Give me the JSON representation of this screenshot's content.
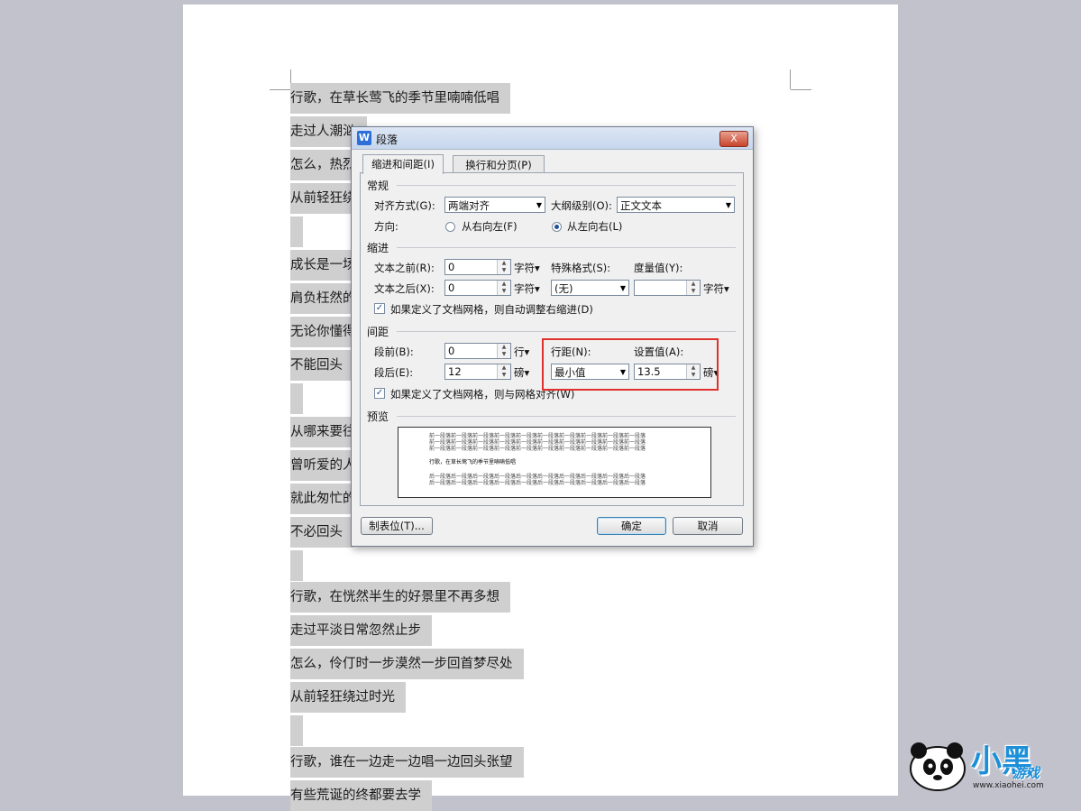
{
  "document": {
    "lines": [
      "行歌，在草长莺飞的季节里喃喃低唱",
      "走过人潮汹",
      "怎么，热烈",
      "从前轻狂绕",
      "",
      "成长是一场",
      "肩负枉然的",
      "无论你懂得",
      "不能回头",
      "",
      "从哪来要往",
      "曾听爱的人",
      "就此匆忙的",
      "不必回头",
      "",
      "行歌，在恍然半生的好景里不再多想",
      "走过平淡日常忽然止步",
      "怎么，伶仃时一步漠然一步回首梦尽处",
      "从前轻狂绕过时光",
      "",
      "行歌，谁在一边走一边唱一边回头张望",
      "有些荒诞的终都要去学"
    ]
  },
  "dialog": {
    "title": "段落",
    "close_label": "X",
    "tabs": [
      {
        "label": "缩进和间距(I)",
        "active": true
      },
      {
        "label": "换行和分页(P)",
        "active": false
      }
    ],
    "general": {
      "section_title": "常规",
      "alignment_label": "对齐方式(G):",
      "alignment_value": "两端对齐",
      "outline_label": "大纲级别(O):",
      "outline_value": "正文文本",
      "direction_label": "方向:",
      "rtl_label": "从右向左(F)",
      "ltr_label": "从左向右(L)",
      "direction_selected": "ltr"
    },
    "indent": {
      "section_title": "缩进",
      "before_label": "文本之前(R):",
      "before_value": "0",
      "before_unit": "字符▾",
      "after_label": "文本之后(X):",
      "after_value": "0",
      "after_unit": "字符▾",
      "special_label": "特殊格式(S):",
      "special_value": "(无)",
      "measure_label": "度量值(Y):",
      "measure_value": "",
      "measure_unit": "字符▾",
      "grid_check_label": "如果定义了文档网格，则自动调整右缩进(D)",
      "grid_checked": true
    },
    "spacing": {
      "section_title": "间距",
      "before_label": "段前(B):",
      "before_value": "0",
      "before_unit": "行▾",
      "after_label": "段后(E):",
      "after_value": "12",
      "after_unit": "磅▾",
      "line_spacing_label": "行距(N):",
      "line_spacing_value": "最小值",
      "set_value_label": "设置值(A):",
      "set_value": "13.5",
      "set_value_unit": "磅▾",
      "grid_check_label": "如果定义了文档网格，则与网格对齐(W)",
      "grid_checked": true
    },
    "preview": {
      "section_title": "预览",
      "prev_para": "前一段落前一段落前一段落前一段落前一段落前一段落前一段落前一段落前一段落前一段落",
      "sample": "行歌，在草长莺飞的季节里喃喃低唱",
      "next_para": "后一段落后一段落后一段落后一段落后一段落后一段落后一段落后一段落后一段落后一段落"
    },
    "buttons": {
      "tabs_label": "制表位(T)...",
      "ok_label": "确定",
      "cancel_label": "取消"
    }
  },
  "watermark": {
    "text": "小黑",
    "sub": "游戏",
    "url": "www.xiaohei.com"
  },
  "colors": {
    "highlight": "#e0302c",
    "background": "#c1c2cc",
    "selection": "#cfcfcf"
  }
}
